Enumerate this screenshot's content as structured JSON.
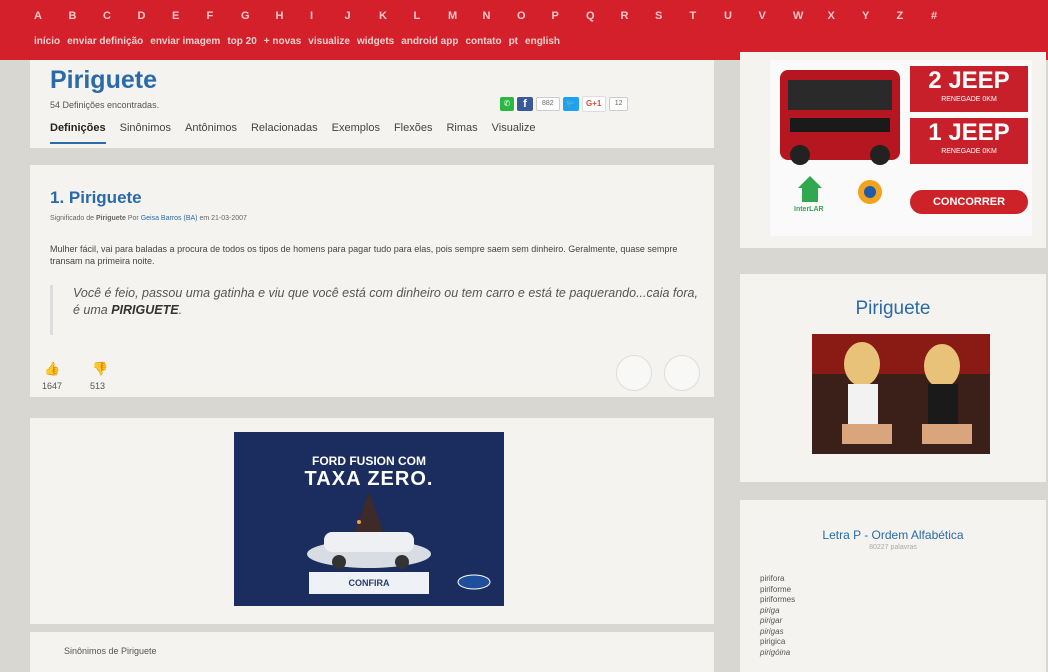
{
  "alphabet": [
    "A",
    "B",
    "C",
    "D",
    "E",
    "F",
    "G",
    "H",
    "I",
    "J",
    "K",
    "L",
    "M",
    "N",
    "O",
    "P",
    "Q",
    "R",
    "S",
    "T",
    "U",
    "V",
    "W",
    "X",
    "Y",
    "Z",
    "#"
  ],
  "menu": [
    "início",
    "enviar definição",
    "enviar imagem",
    "top 20",
    "+ novas",
    "visualize",
    "widgets",
    "android app",
    "contato",
    "pt",
    "english"
  ],
  "header": {
    "title": "Piriguete",
    "count": "54 Definições encontradas.",
    "share_count": "882",
    "gplus_label": "G+1",
    "gplus_count": "12",
    "tabs": [
      "Definições",
      "Sinônimos",
      "Antônimos",
      "Relacionadas",
      "Exemplos",
      "Flexões",
      "Rimas",
      "Visualize"
    ]
  },
  "definition": {
    "title": "1. Piriguete",
    "meta_prefix": "Significado de",
    "meta_word": "Piriguete",
    "meta_por": "Por",
    "author": "Geisa Barros (BA)",
    "date": "em 21-03-2007",
    "text": "Mulher fácil, vai para baladas a procura de todos os tipos de homens para pagar tudo para elas, pois sempre saem sem dinheiro. Geralmente, quase sempre transam na primeira noite.",
    "example_text": "Você é feio, passou uma gatinha e viu que você está com dinheiro ou tem carro e está te paquerando...caia fora, é uma ",
    "example_word": "PIRIGUETE",
    "example_end": ".",
    "likes": "1647",
    "dislikes": "513"
  },
  "ford_ad": {
    "line1": "FORD FUSION COM",
    "line2": "TAXA ZERO.",
    "cta": "CONFIRA"
  },
  "synonyms_title": "Sinônimos de Piriguete",
  "jeep_ad": {
    "box1_big": "2 JEEP",
    "box1_small": "RENEGADE 0KM",
    "box2_big": "1 JEEP",
    "box2_small": "RENEGADE 0KM",
    "brand1": "InterLAR",
    "cta": "CONCORRER"
  },
  "sidebar": {
    "title": "Piriguete",
    "letter_title": "Letra P - Ordem Alfabética",
    "letter_sub": "80227 palavras",
    "words": [
      "pirifora",
      "piriforme",
      "piriformes",
      "piriga",
      "pirigar",
      "pirigas",
      "pirigica",
      "pirigóina"
    ]
  },
  "colors": {
    "brand_red": "#d4202a",
    "link_blue": "#2a6aa8"
  }
}
